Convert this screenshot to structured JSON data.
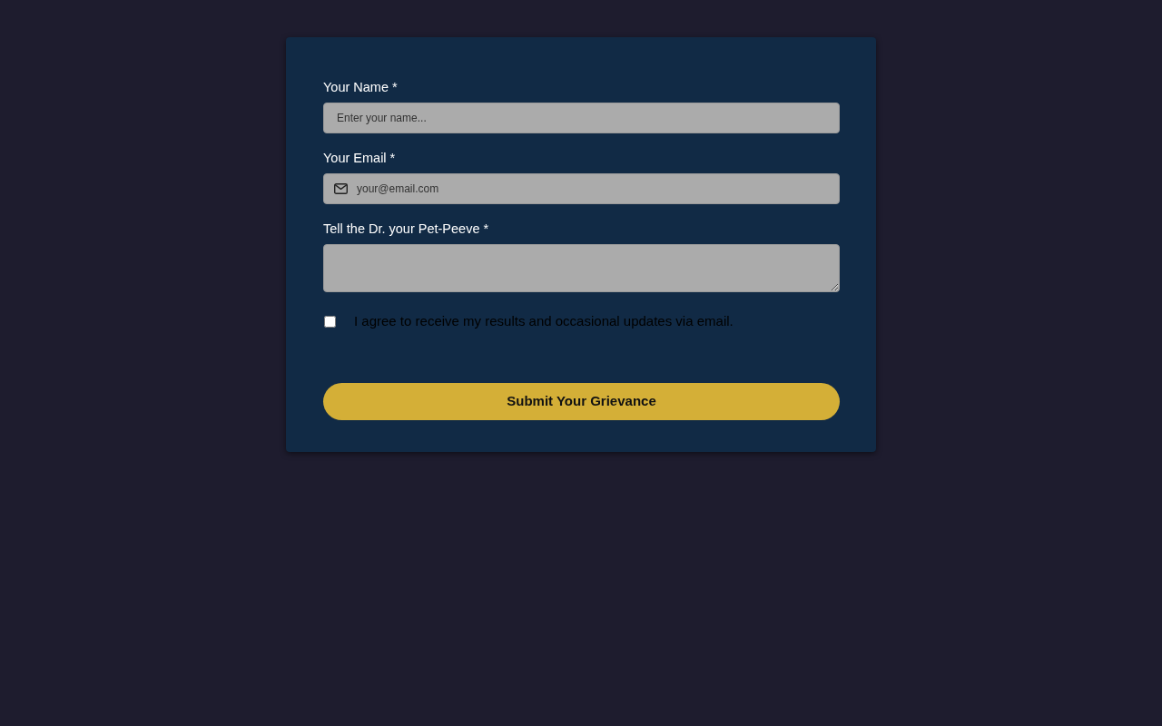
{
  "form": {
    "fields": [
      {
        "kind": "text",
        "label": "Your Name *",
        "placeholder": "Enter your name..."
      },
      {
        "kind": "email",
        "label": "Your Email *",
        "placeholder": "your@email.com"
      },
      {
        "kind": "textarea",
        "label": "Tell the Dr. your Pet-Peeve *"
      }
    ],
    "consent": {
      "label": "I agree to receive my results and occasional updates via email.",
      "checked": false
    },
    "submit_button": "Submit Your Grievance"
  }
}
